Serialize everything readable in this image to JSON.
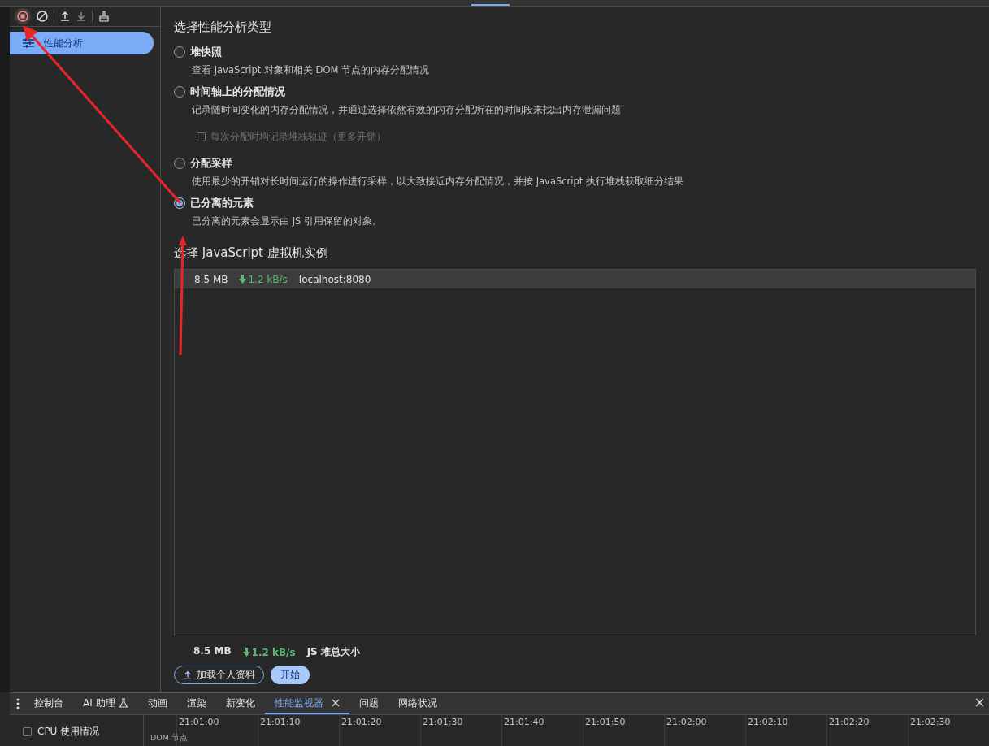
{
  "sidebar": {
    "items": [
      {
        "label": "性能分析",
        "selected": true
      }
    ]
  },
  "profile_types": {
    "heading": "选择性能分析类型",
    "options": [
      {
        "label": "堆快照",
        "description": "查看 JavaScript 对象和相关 DOM 节点的内存分配情况",
        "selected": false
      },
      {
        "label": "时间轴上的分配情况",
        "description": "记录随时间变化的内存分配情况，并通过选择依然有效的内存分配所在的时间段来找出内存泄漏问题",
        "selected": false,
        "sub_option": {
          "label": "每次分配时均记录堆栈轨迹（更多开销）",
          "checked": false,
          "disabled": true
        }
      },
      {
        "label": "分配采样",
        "description": "使用最少的开销对长时间运行的操作进行采样，以大致接近内存分配情况，并按 JavaScript 执行堆栈获取细分结果",
        "selected": false
      },
      {
        "label": "已分离的元素",
        "description": "已分离的元素会显示由 JS 引用保留的对象。",
        "selected": true
      }
    ]
  },
  "vm": {
    "heading": "选择 JavaScript 虚拟机实例",
    "instances": [
      {
        "size": "8.5 MB",
        "rate": "1.2 kB/s",
        "url": "localhost:8080",
        "selected": true
      }
    ]
  },
  "totals": {
    "size": "8.5 MB",
    "rate": "1.2 kB/s",
    "label": "JS 堆总大小"
  },
  "buttons": {
    "load": "加载个人资料",
    "start": "开始"
  },
  "drawer": {
    "tabs": [
      {
        "label": "控制台",
        "selected": false,
        "experimental": false
      },
      {
        "label": "AI 助理",
        "selected": false,
        "experimental": true
      },
      {
        "label": "动画",
        "selected": false,
        "experimental": false
      },
      {
        "label": "渲染",
        "selected": false,
        "experimental": false
      },
      {
        "label": "新变化",
        "selected": false,
        "experimental": false
      },
      {
        "label": "性能监视器",
        "selected": true,
        "experimental": false
      },
      {
        "label": "问题",
        "selected": false,
        "experimental": false
      },
      {
        "label": "网络状况",
        "selected": false,
        "experimental": false
      }
    ],
    "metrics": [
      {
        "label": "CPU 使用情况",
        "checked": false
      }
    ],
    "timeline": {
      "series_label": "DOM 节点",
      "ticks": [
        "21:01:00",
        "21:01:10",
        "21:01:20",
        "21:01:30",
        "21:01:40",
        "21:01:50",
        "21:02:00",
        "21:02:10",
        "21:02:20",
        "21:02:30"
      ]
    }
  }
}
